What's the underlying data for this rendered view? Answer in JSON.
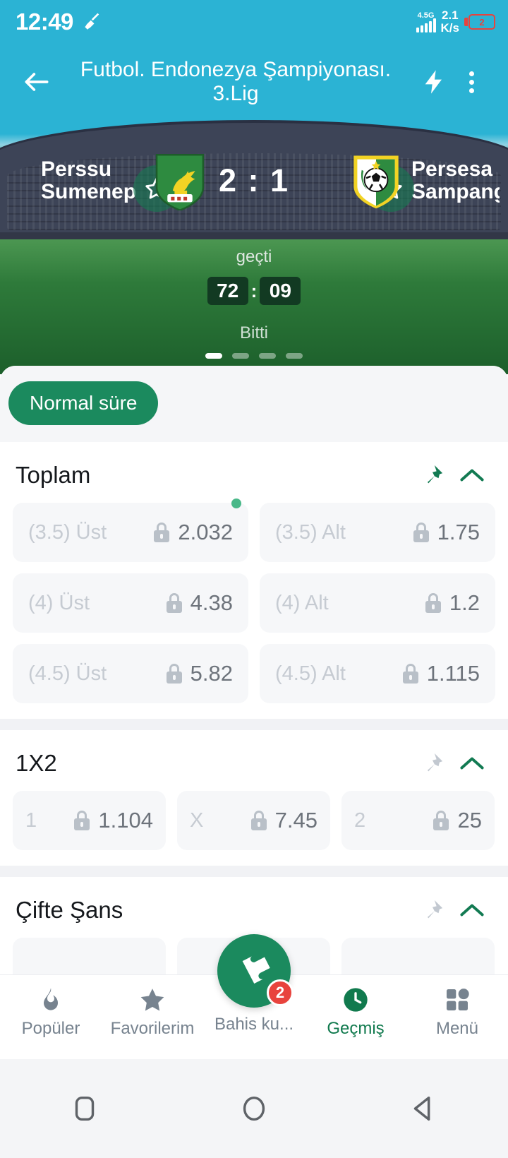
{
  "statusbar": {
    "time": "12:49",
    "cleaner_icon": "broom-icon",
    "network_type": "4.5G",
    "data_rate_value": "2.1",
    "data_rate_unit": "K/s",
    "battery_percent": "2"
  },
  "appbar": {
    "back_icon": "back-arrow-icon",
    "title": "Futbol. Endonezya Şampiyonası. 3.Lig",
    "flash_icon": "lightning-icon",
    "overflow_icon": "more-vertical-icon"
  },
  "match": {
    "home_team": "Perssu Sumenep",
    "away_team": "Persesa Sampang",
    "score": "2 : 1",
    "period_text": "geçti",
    "clock_minutes": "72",
    "clock_separator": ":",
    "clock_seconds": "09",
    "status": "Bitti",
    "home_logo": "pegasus-crest-icon",
    "away_logo": "football-crest-icon",
    "favorite_icon": "star-outline-icon",
    "pagination": {
      "total": 4,
      "active_index": 0
    }
  },
  "filters": [
    {
      "label": "Normal süre",
      "active": true
    }
  ],
  "markets": [
    {
      "title": "Toplam",
      "pinned": true,
      "pin_icon": "pin-icon",
      "collapse_icon": "chevron-up-icon",
      "layout": "half",
      "outcomes": [
        {
          "label": "(3.5) Üst",
          "odds": "2.032",
          "locked": true,
          "lock_icon": "lock-icon",
          "new_dot": true
        },
        {
          "label": "(3.5) Alt",
          "odds": "1.75",
          "locked": true,
          "lock_icon": "lock-icon",
          "new_dot": false
        },
        {
          "label": "(4) Üst",
          "odds": "4.38",
          "locked": true,
          "lock_icon": "lock-icon",
          "new_dot": false
        },
        {
          "label": "(4) Alt",
          "odds": "1.2",
          "locked": true,
          "lock_icon": "lock-icon",
          "new_dot": false
        },
        {
          "label": "(4.5) Üst",
          "odds": "5.82",
          "locked": true,
          "lock_icon": "lock-icon",
          "new_dot": false
        },
        {
          "label": "(4.5) Alt",
          "odds": "1.115",
          "locked": true,
          "lock_icon": "lock-icon",
          "new_dot": false
        }
      ]
    },
    {
      "title": "1X2",
      "pinned": false,
      "pin_icon": "pin-icon",
      "collapse_icon": "chevron-up-icon",
      "layout": "third",
      "outcomes": [
        {
          "label": "1",
          "odds": "1.104",
          "locked": true,
          "lock_icon": "lock-icon",
          "new_dot": false
        },
        {
          "label": "X",
          "odds": "7.45",
          "locked": true,
          "lock_icon": "lock-icon",
          "new_dot": false
        },
        {
          "label": "2",
          "odds": "25",
          "locked": true,
          "lock_icon": "lock-icon",
          "new_dot": false
        }
      ]
    },
    {
      "title": "Çifte Şans",
      "pinned": false,
      "pin_icon": "pin-icon",
      "collapse_icon": "chevron-up-icon",
      "layout": "third",
      "outcomes": [
        {
          "label": "",
          "odds": "",
          "locked": true,
          "lock_icon": "lock-icon",
          "new_dot": false
        },
        {
          "label": "",
          "odds": "",
          "locked": true,
          "lock_icon": "lock-icon",
          "new_dot": false
        },
        {
          "label": "",
          "odds": "",
          "locked": true,
          "lock_icon": "lock-icon",
          "new_dot": false
        }
      ]
    }
  ],
  "bottomnav": {
    "items": [
      {
        "label": "Popüler",
        "icon": "flame-icon",
        "active": false
      },
      {
        "label": "Favorilerim",
        "icon": "star-icon",
        "active": false
      },
      {
        "label": "Bahis ku...",
        "icon": "ticket-icon",
        "active": false,
        "badge": "2",
        "is_fab": true
      },
      {
        "label": "Geçmiş",
        "icon": "clock-icon",
        "active": true
      },
      {
        "label": "Menü",
        "icon": "grid-icon",
        "active": false
      }
    ]
  },
  "androidnav": {
    "recent_icon": "square-icon",
    "home_icon": "circle-icon",
    "back_icon": "triangle-back-icon"
  },
  "colors": {
    "status_bar": "#2bb3d4",
    "accent_green": "#1b8a5e",
    "badge_red": "#e8433d",
    "locked_text": "#6d737b"
  }
}
